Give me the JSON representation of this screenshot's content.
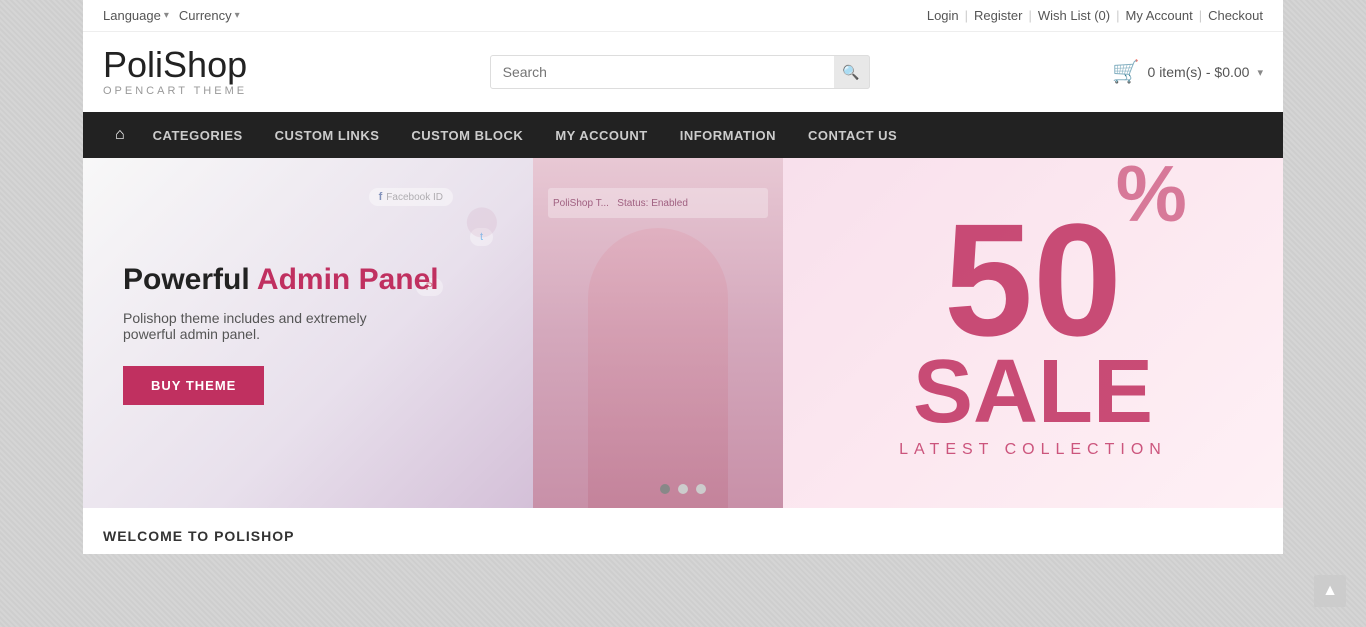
{
  "topbar": {
    "language_label": "Language",
    "currency_label": "Currency",
    "login_label": "Login",
    "register_label": "Register",
    "wishlist_label": "Wish List (0)",
    "myaccount_label": "My Account",
    "checkout_label": "Checkout"
  },
  "header": {
    "logo_bold": "Poli",
    "logo_thin": "Shop",
    "logo_sub": "OPENCART THEME",
    "search_placeholder": "Search",
    "cart_label": "0 item(s) - $0.00"
  },
  "navbar": {
    "home_icon": "⌂",
    "items": [
      {
        "label": "CATEGORIES"
      },
      {
        "label": "CUSTOM LINKS"
      },
      {
        "label": "CUSTOM BLOCK"
      },
      {
        "label": "MY ACCOUNT"
      },
      {
        "label": "INFORMATION"
      },
      {
        "label": "CONTACT US"
      }
    ]
  },
  "hero": {
    "slide1": {
      "title_black": "Powerful ",
      "title_accent": "Admin Panel",
      "subtitle": "Polishop theme includes and extremely powerful admin panel.",
      "button_label": "BUY THEME"
    },
    "slide2": {
      "number": "50",
      "percent": "%",
      "word": "SALE",
      "collection": "LATEST COLLECTION"
    },
    "dots": [
      "dot1",
      "dot2",
      "dot3"
    ]
  },
  "welcome": {
    "title": "WELCOME TO POLISHOP"
  },
  "scrolltop": {
    "icon": "▲"
  }
}
